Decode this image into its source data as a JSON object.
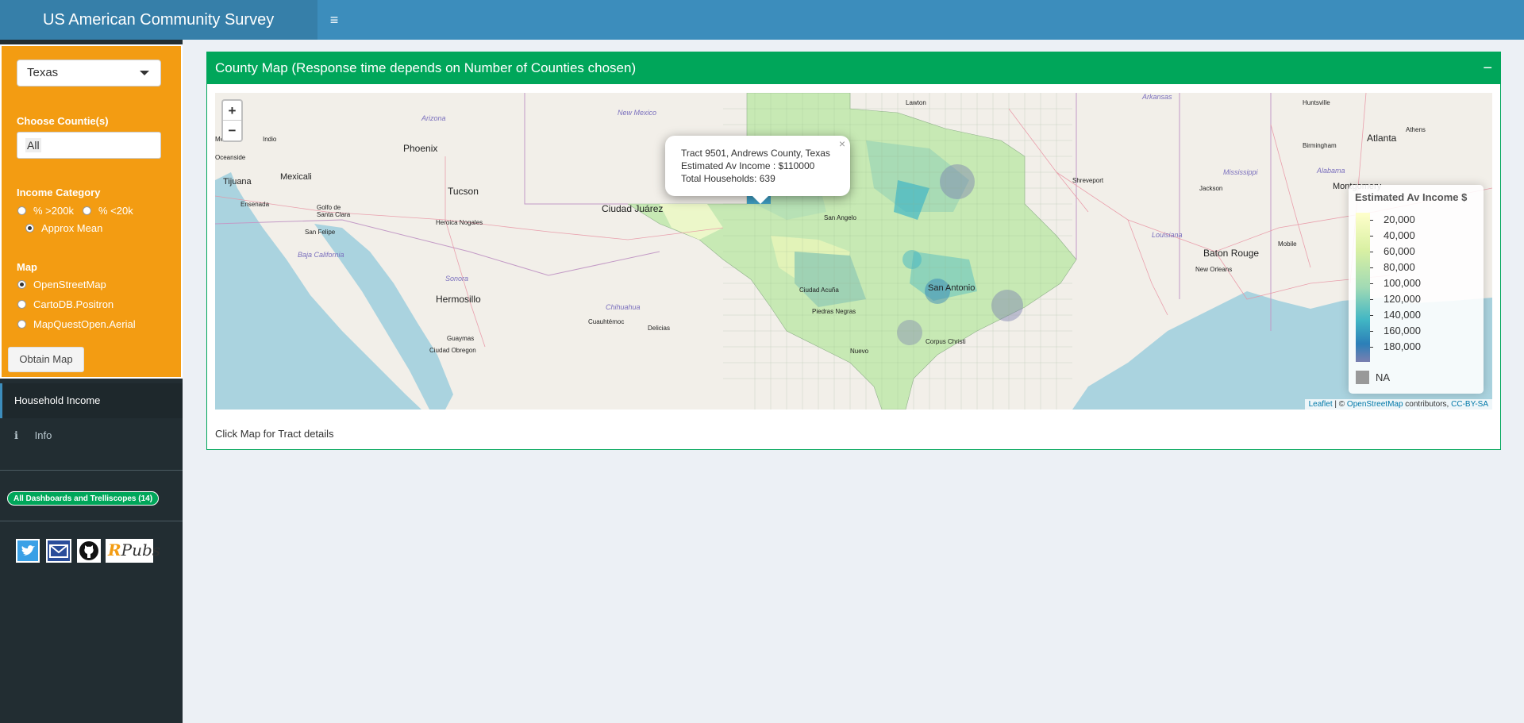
{
  "header": {
    "title": "US American Community Survey",
    "toggle_icon": "≡"
  },
  "sidebar": {
    "state_select": "Texas",
    "counties_label": "Choose Countie(s)",
    "counties_value": "All",
    "income_label": "Income Category",
    "income_options": [
      "% >200k",
      "% <20k",
      "Approx Mean"
    ],
    "income_selected": "Approx Mean",
    "map_label": "Map",
    "map_options": [
      "OpenStreetMap",
      "CartoDB.Positron",
      "MapQuestOpen.Aerial"
    ],
    "map_selected": "OpenStreetMap",
    "obtain_button": "Obtain Map",
    "menu": [
      {
        "label": "Household Income",
        "icon": "",
        "active": true
      },
      {
        "label": "Info",
        "icon": "info-icon",
        "active": false
      }
    ],
    "dashboards_badge": "All Dashboards and Trelliscopes (14)",
    "social": {
      "rpubs_label": "RPubs"
    }
  },
  "box": {
    "title": "County Map (Response time depends on Number of Counties chosen)",
    "collapse_icon": "−",
    "footer_note": "Click Map for Tract details"
  },
  "map": {
    "zoom_in": "+",
    "zoom_out": "−",
    "popup": {
      "line1": "Tract 9501, Andrews County, Texas",
      "line2": "Estimated Av Income : $110000",
      "line3": "Total Households: 639",
      "close": "×"
    },
    "legend": {
      "title": "Estimated Av Income $",
      "ticks": [
        "20,000",
        "40,000",
        "60,000",
        "80,000",
        "100,000",
        "120,000",
        "140,000",
        "160,000",
        "180,000"
      ],
      "na_label": "NA",
      "na_color": "#999999"
    },
    "attribution": {
      "leaflet": "Leaflet",
      "sep": " | © ",
      "osm": "OpenStreetMap",
      "contrib": " contributors, ",
      "license": "CC-BY-SA"
    },
    "labels": {
      "phoenix": "Phoenix",
      "tucson": "Tucson",
      "tijuana": "Tijuana",
      "mexicali": "Mexicali",
      "ciudad_juarez": "Ciudad Juárez",
      "hermosillo": "Hermosillo",
      "heroica_nogales": "Heroica Nogales",
      "ensenada": "Ensenada",
      "san_felipe": "San Felipe",
      "golfo": "Golfo de Santa Clara",
      "guaymas": "Guaymas",
      "cuauhtemoc": "Cuauhtémoc",
      "delicias": "Delicias",
      "ciudad_acuna": "Ciudad Acuña",
      "piedras": "Piedras Negras",
      "san_antonio": "San Antonio",
      "lawton": "Lawton",
      "shreveport": "Shreveport",
      "jackson": "Jackson",
      "baton_rouge": "Baton Rouge",
      "new_orleans": "New Orleans",
      "mobile": "Mobile",
      "atlanta": "Atlanta",
      "birmingham": "Birmingham",
      "montgomery": "Montgomery",
      "huntsville": "Huntsville",
      "athens": "Athens",
      "indio": "Indio",
      "oceanside": "Oceanside",
      "mesa": "Mesa",
      "san_angelo": "San Angelo",
      "corpus": "Corpus Christi",
      "arizona": "Arizona",
      "new_mexico": "New Mexico",
      "baja": "Baja California",
      "sonora": "Sonora",
      "chihuahua": "Chihuahua",
      "mississippi": "Mississippi",
      "alabama": "Alabama",
      "louisiana": "Louisiana",
      "arkansas": "Arkansas",
      "ciudad_obregon": "Ciudad Obregon",
      "nuevo": "Nuevo"
    }
  },
  "colors": {
    "header": "#3c8dbc",
    "logo_bg": "#367fa9",
    "sidebar": "#222d32",
    "controls": "#f39c12",
    "box_accent": "#00a65a"
  }
}
